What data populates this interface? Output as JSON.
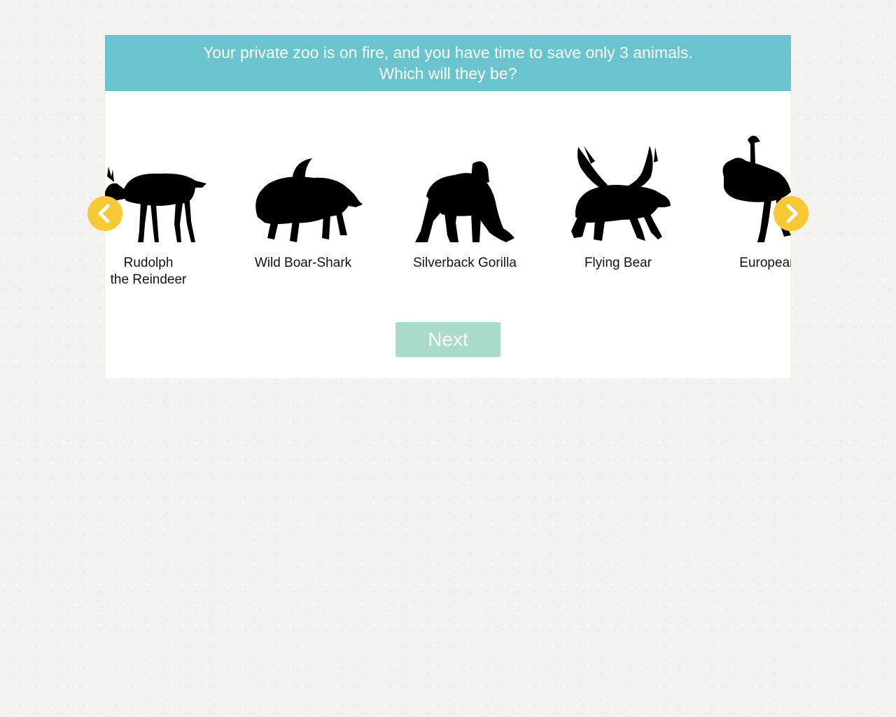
{
  "banner": {
    "line1": "Your private zoo is on fire, and you have time to save only 3 animals.",
    "line2": "Which will they be?"
  },
  "animals": [
    {
      "label": "Rudolph\nthe Reindeer",
      "icon": "reindeer-silhouette-icon"
    },
    {
      "label": "Wild Boar-Shark",
      "icon": "boar-shark-silhouette-icon"
    },
    {
      "label": "Silverback Gorilla",
      "icon": "gorilla-silhouette-icon"
    },
    {
      "label": "Flying Bear",
      "icon": "flying-bear-silhouette-icon"
    },
    {
      "label": "European C",
      "icon": "ostrich-silhouette-icon"
    }
  ],
  "nav": {
    "prev_icon": "chevron-left-icon",
    "next_icon": "chevron-right-icon"
  },
  "next_button": {
    "label": "Next"
  },
  "colors": {
    "banner": "#6ac4ce",
    "arrow": "#f8c835",
    "next_button": "#a8dbc9",
    "background": "#f3f2f0"
  }
}
